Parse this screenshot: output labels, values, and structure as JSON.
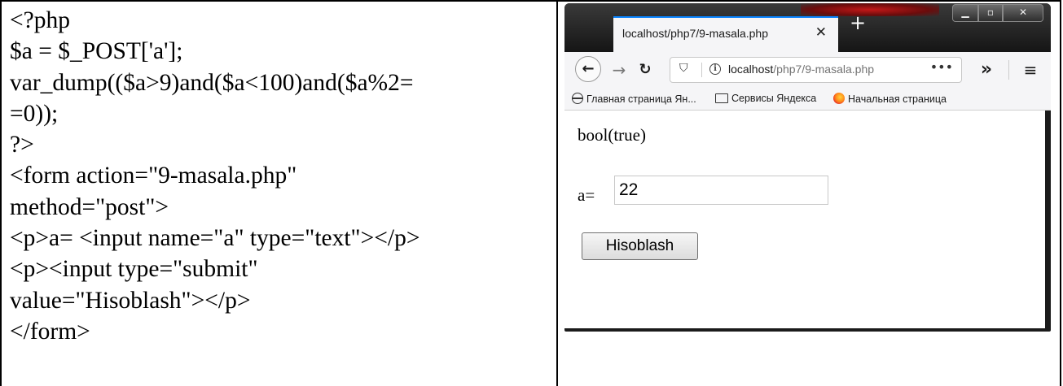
{
  "code": {
    "lines": [
      "<?php",
      "$a = $_POST['a'];",
      "var_dump(($a>9)and($a<100)and($a%2=",
      "=0));",
      "?>",
      "<form action=\"9-masala.php\"",
      "method=\"post\">",
      "<p>a= <input name=\"a\" type=\"text\"></p>",
      "<p><input type=\"submit\"",
      "value=\"Hisoblash\"></p>",
      "</form>"
    ]
  },
  "browser": {
    "tab_title": "localhost/php7/9-masala.php",
    "tab_close_icon": "close-icon",
    "new_tab_icon": "plus-icon",
    "window_controls": {
      "minimize_icon": "minimize-icon",
      "maximize_icon": "maximize-icon",
      "close_icon": "close-icon"
    },
    "url_host": "localhost",
    "url_path": "/php7/9-masala.php",
    "url_more": "•••",
    "overflow": "»",
    "menu": "≡",
    "bookmarks": [
      {
        "label": "Главная страница Ян...",
        "icon": "globe-icon"
      },
      {
        "label": "Сервисы Яндекса",
        "icon": "folder-icon"
      },
      {
        "label": "Начальная страница",
        "icon": "firefox-icon"
      }
    ],
    "accent_color": "#0a84ff"
  },
  "page": {
    "output": "bool(true)",
    "input_label": "a=",
    "input_value": "22",
    "button_label": "Hisoblash"
  }
}
